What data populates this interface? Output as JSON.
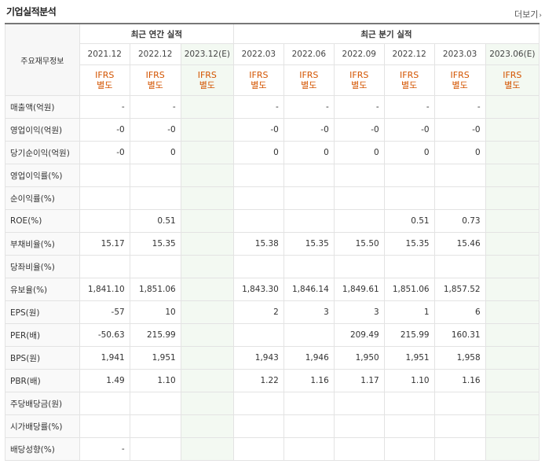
{
  "header": {
    "title": "기업실적분석",
    "more": "더보기",
    "more_chevron": "›"
  },
  "table": {
    "label_header": "주요재무정보",
    "annual_group": "최근 연간 실적",
    "quarter_group": "최근 분기 실적",
    "periods": [
      "2021.12",
      "2022.12",
      "2023.12(E)",
      "2022.03",
      "2022.06",
      "2022.09",
      "2022.12",
      "2023.03",
      "2023.06(E)"
    ],
    "ifrs_line1": "IFRS",
    "ifrs_line2": "별도",
    "rows": [
      {
        "label": "매출액(억원)",
        "values": [
          "-",
          "-",
          "",
          "-",
          "-",
          "-",
          "-",
          "-",
          ""
        ]
      },
      {
        "label": "영업이익(억원)",
        "values": [
          "-0",
          "-0",
          "",
          "-0",
          "-0",
          "-0",
          "-0",
          "-0",
          ""
        ]
      },
      {
        "label": "당기순이익(억원)",
        "values": [
          "-0",
          "0",
          "",
          "0",
          "0",
          "0",
          "0",
          "0",
          ""
        ]
      },
      {
        "label": "영업이익률(%)",
        "values": [
          "",
          "",
          "",
          "",
          "",
          "",
          "",
          "",
          ""
        ]
      },
      {
        "label": "순이익률(%)",
        "values": [
          "",
          "",
          "",
          "",
          "",
          "",
          "",
          "",
          ""
        ]
      },
      {
        "label": "ROE(%)",
        "values": [
          "",
          "0.51",
          "",
          "",
          "",
          "",
          "0.51",
          "0.73",
          ""
        ]
      },
      {
        "label": "부채비율(%)",
        "values": [
          "15.17",
          "15.35",
          "",
          "15.38",
          "15.35",
          "15.50",
          "15.35",
          "15.46",
          ""
        ]
      },
      {
        "label": "당좌비율(%)",
        "values": [
          "",
          "",
          "",
          "",
          "",
          "",
          "",
          "",
          ""
        ]
      },
      {
        "label": "유보율(%)",
        "values": [
          "1,841.10",
          "1,851.06",
          "",
          "1,843.30",
          "1,846.14",
          "1,849.61",
          "1,851.06",
          "1,857.52",
          ""
        ]
      },
      {
        "label": "EPS(원)",
        "values": [
          "-57",
          "10",
          "",
          "2",
          "3",
          "3",
          "1",
          "6",
          ""
        ]
      },
      {
        "label": "PER(배)",
        "values": [
          "-50.63",
          "215.99",
          "",
          "",
          "",
          "209.49",
          "215.99",
          "160.31",
          ""
        ]
      },
      {
        "label": "BPS(원)",
        "values": [
          "1,941",
          "1,951",
          "",
          "1,943",
          "1,946",
          "1,950",
          "1,951",
          "1,958",
          ""
        ]
      },
      {
        "label": "PBR(배)",
        "values": [
          "1.49",
          "1.10",
          "",
          "1.22",
          "1.16",
          "1.17",
          "1.10",
          "1.16",
          ""
        ]
      },
      {
        "label": "주당배당금(원)",
        "values": [
          "",
          "",
          "",
          "",
          "",
          "",
          "",
          "",
          ""
        ]
      },
      {
        "label": "시가배당률(%)",
        "values": [
          "",
          "",
          "",
          "",
          "",
          "",
          "",
          "",
          ""
        ]
      },
      {
        "label": "배당성향(%)",
        "values": [
          "-",
          "",
          "",
          "",
          "",
          "",
          "",
          "",
          ""
        ]
      }
    ],
    "group_starts": [
      0,
      3,
      6,
      9,
      13
    ],
    "colors": {
      "negative": "#dd1111",
      "ifrs": "#d35400",
      "estimate_bg": "#f3f9f2"
    }
  }
}
